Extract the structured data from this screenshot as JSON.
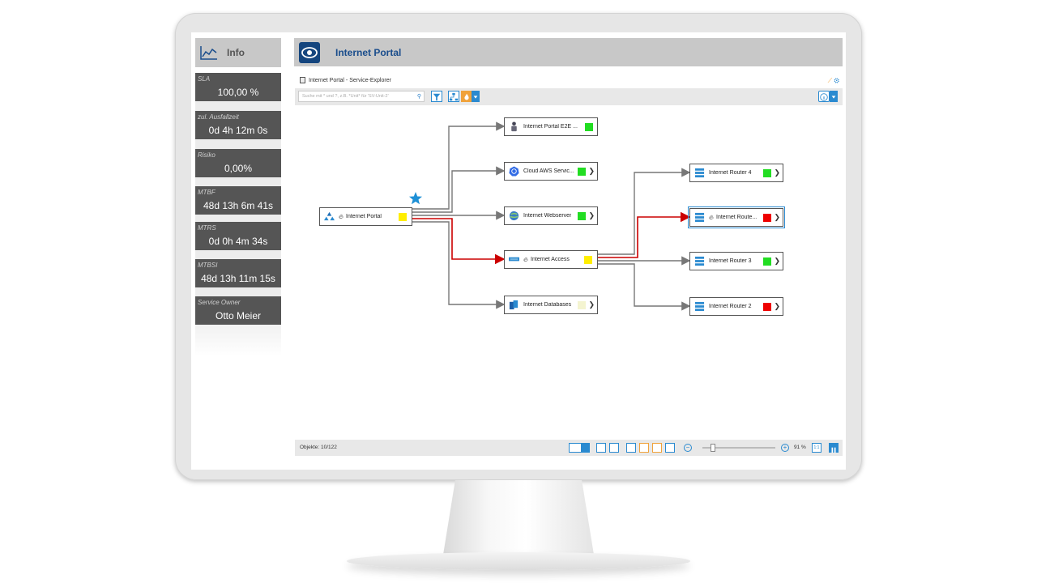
{
  "info": {
    "title": "Info",
    "kpis": [
      {
        "label": "SLA",
        "value": "100,00 %"
      },
      {
        "label": "zul. Ausfallzeit",
        "value": "0d 4h 12m 0s"
      },
      {
        "label": "Risiko",
        "value": "0,00%"
      },
      {
        "label": "MTBF",
        "value": "48d 13h 6m 41s"
      },
      {
        "label": "MTRS",
        "value": "0d 0h 4m 34s"
      },
      {
        "label": "MTBSI",
        "value": "48d 13h 11m 15s"
      },
      {
        "label": "Service Owner",
        "value": "Otto Meier"
      }
    ]
  },
  "header": {
    "title": "Internet Portal"
  },
  "explorer": {
    "title": "Internet Portal - Service-Explorer",
    "search_placeholder": "Suche mit * und ?, z.B. *Unit* für 'SV-Unit-2'",
    "status_objects": "Objekte: 10/122",
    "zoom": "91 %",
    "page_btn": "1:1"
  },
  "nodes": {
    "portal": {
      "label": "Internet Portal",
      "status": "#ffee00"
    },
    "e2e": {
      "label": "Internet Portal E2E ...",
      "status": "#22dd22"
    },
    "aws": {
      "label": "Cloud AWS Servic...",
      "status": "#22dd22"
    },
    "webserver": {
      "label": "Internet Webserver",
      "status": "#22dd22"
    },
    "access": {
      "label": "Internet Access",
      "status": "#ffee00"
    },
    "databases": {
      "label": "Internet Databases",
      "status": "#f4f4d0"
    },
    "router4": {
      "label": "Internet Router 4",
      "status": "#22dd22"
    },
    "router1": {
      "label": "Internet Route...",
      "status": "#ee0000"
    },
    "router3": {
      "label": "Internet Router 3",
      "status": "#22dd22"
    },
    "router2": {
      "label": "Internet Router 2",
      "status": "#ee0000"
    }
  },
  "colors": {
    "accent": "#2a8ad0",
    "header_title": "#1a4d8c",
    "critical_edge": "#cc0000",
    "edge": "#777777"
  }
}
